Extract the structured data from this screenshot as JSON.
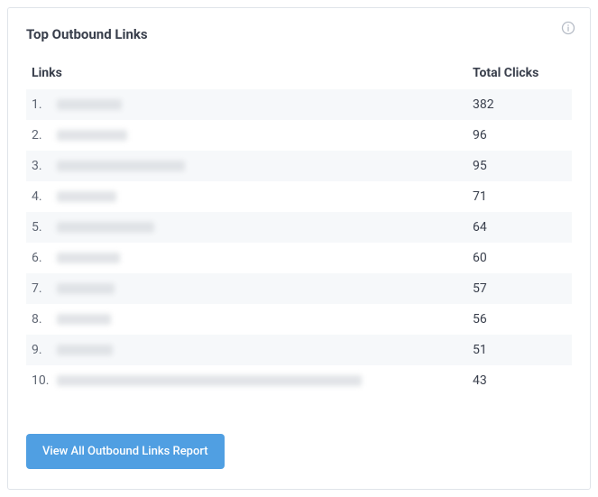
{
  "card": {
    "title": "Top Outbound Links",
    "headers": {
      "links": "Links",
      "clicks": "Total Clicks"
    },
    "rows": [
      {
        "index": "1.",
        "link_blur_width": 72,
        "clicks": "382"
      },
      {
        "index": "2.",
        "link_blur_width": 78,
        "clicks": "96"
      },
      {
        "index": "3.",
        "link_blur_width": 142,
        "clicks": "95"
      },
      {
        "index": "4.",
        "link_blur_width": 66,
        "clicks": "71"
      },
      {
        "index": "5.",
        "link_blur_width": 108,
        "clicks": "64"
      },
      {
        "index": "6.",
        "link_blur_width": 70,
        "clicks": "60"
      },
      {
        "index": "7.",
        "link_blur_width": 64,
        "clicks": "57"
      },
      {
        "index": "8.",
        "link_blur_width": 60,
        "clicks": "56"
      },
      {
        "index": "9.",
        "link_blur_width": 62,
        "clicks": "51"
      },
      {
        "index": "10.",
        "link_blur_width": 338,
        "clicks": "43"
      }
    ],
    "button_label": "View All Outbound Links Report"
  }
}
